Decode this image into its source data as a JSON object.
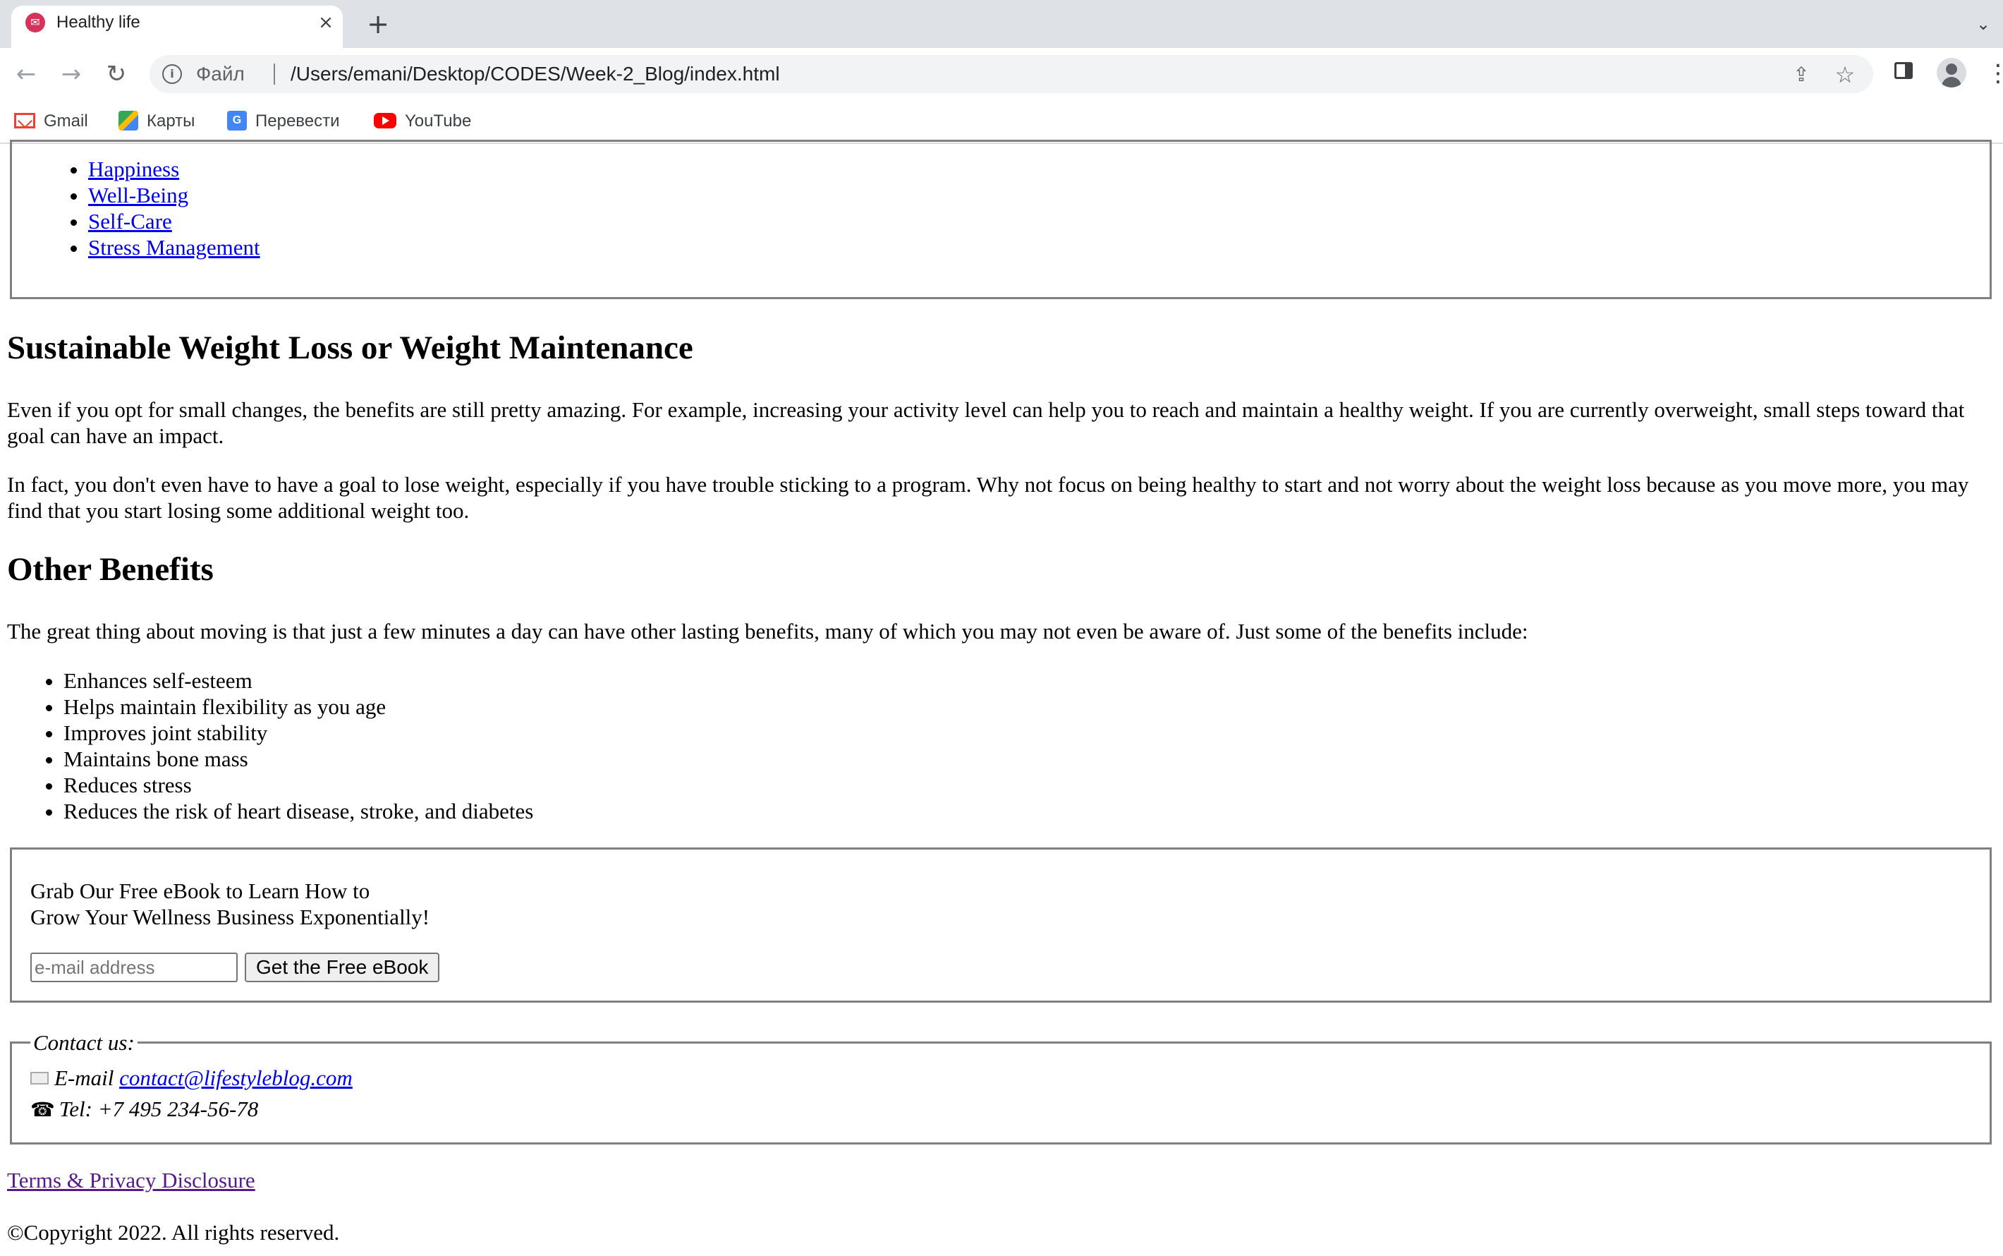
{
  "browser": {
    "tab_title": "Healthy life",
    "tab_close": "×",
    "new_tab": "+",
    "tab_list": "⌄",
    "back": "←",
    "forward": "→",
    "reload": "↻",
    "scheme_label": "Файл",
    "url": "/Users/emani/Desktop/CODES/Week-2_Blog/index.html",
    "share": "⇪",
    "star": "☆",
    "menu": "⋮",
    "bookmarks": [
      {
        "label": "Gmail",
        "icon": "gmail-icon"
      },
      {
        "label": "Карты",
        "icon": "maps-icon"
      },
      {
        "label": "Перевести",
        "icon": "translate-icon"
      },
      {
        "label": "YouTube",
        "icon": "youtube-icon"
      }
    ]
  },
  "topics": [
    "Happiness",
    "Well-Being",
    "Self-Care",
    "Stress Management"
  ],
  "section1": {
    "heading": "Sustainable Weight Loss or Weight Maintenance",
    "p1": "Even if you opt for small changes, the benefits are still pretty amazing. For example, increasing your activity level can help you to reach and maintain a healthy weight. If you are currently overweight, small steps toward that goal can have an impact.",
    "p2": "In fact, you don't even have to have a goal to lose weight, especially if you have trouble sticking to a program. Why not focus on being healthy to start and not worry about the weight loss because as you move more, you may find that you start losing some additional weight too."
  },
  "section2": {
    "heading": "Other Benefits",
    "p1": "The great thing about moving is that just a few minutes a day can have other lasting benefits, many of which you may not even be aware of. Just some of the benefits include:",
    "benefits": [
      "Enhances self-esteem",
      "Helps maintain flexibility as you age",
      "Improves joint stability",
      "Maintains bone mass",
      "Reduces stress",
      "Reduces the risk of heart disease, stroke, and diabetes"
    ]
  },
  "ebook": {
    "line1": "Grab Our Free eBook to Learn How to",
    "line2": "Grow Your Wellness Business Exponentially!",
    "email_placeholder": "e-mail address",
    "button_label": "Get the Free eBook"
  },
  "contact": {
    "legend": "Contact us:",
    "email_label": "E-mail",
    "email": "contact@lifestyleblog.com",
    "phone_symbol": "☎",
    "tel": "Tel: +7 495 234-56-78"
  },
  "footer": {
    "terms": "Terms & Privacy Disclosure",
    "copyright": "©Copyright 2022. All rights reserved."
  }
}
